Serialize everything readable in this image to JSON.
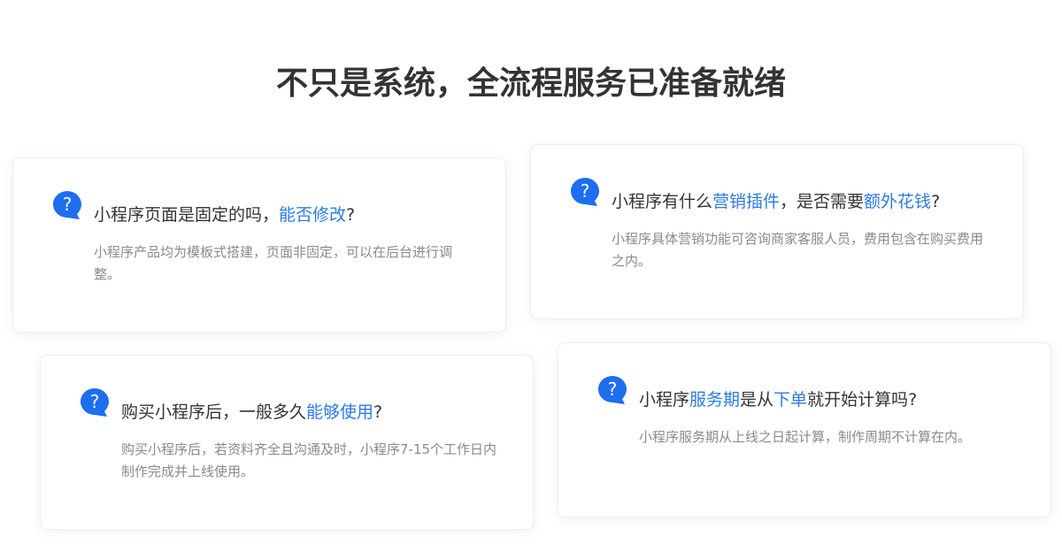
{
  "page_title": "不只是系统，全流程服务已准备就绪",
  "colors": {
    "accent": "#2d7be5",
    "icon_blue": "#1e6ef0",
    "title_text": "#333333",
    "answer_text": "#8a8a8a"
  },
  "icon": "question-bubble-icon",
  "faqs": [
    {
      "question_parts": [
        "小程序页面是固定的吗，",
        "能否修改",
        "?"
      ],
      "answer": "小程序产品均为模板式搭建，页面非固定，可以在后台进行调整。"
    },
    {
      "question_parts": [
        "小程序有什么",
        "营销插件",
        "，是否需要",
        "额外花钱",
        "?"
      ],
      "answer": "小程序具体营销功能可咨询商家客服人员，费用包含在购买费用之内。"
    },
    {
      "question_parts": [
        "购买小程序后，一般多久",
        "能够使用",
        "?"
      ],
      "answer": "购买小程序后，若资料齐全且沟通及时，小程序7-15个工作日内制作完成并上线使用。"
    },
    {
      "question_parts": [
        "小程序",
        "服务期",
        "是从",
        "下单",
        "就开始计算吗?"
      ],
      "answer": "小程序服务期从上线之日起计算，制作周期不计算在内。"
    }
  ]
}
